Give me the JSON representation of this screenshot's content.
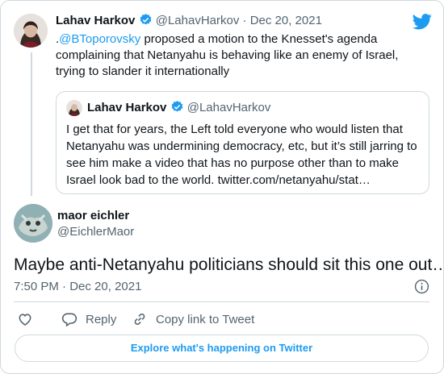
{
  "reply_to": {
    "author_name": "Lahav Harkov",
    "author_handle": "@LahavHarkov",
    "separator": "·",
    "date": "Dec 20, 2021",
    "text_prefix": ".",
    "mention": "@BToporovsky",
    "text_rest_line1": " proposed a motion to the Knesset's agenda",
    "text_line2": "complaining that Netanyahu is behaving like an enemy of Israel,",
    "text_line3": "trying to slander it internationally"
  },
  "quoted": {
    "author_name": "Lahav Harkov",
    "author_handle": "@LahavHarkov",
    "lines": [
      "I get that for years, the Left told everyone who would listen that",
      "Netanyahu was undermining democracy, etc, but it’s still jarring to",
      "see him make a video that has no purpose other than to make",
      "Israel look bad to the world. twitter.com/netanyahu/stat…"
    ]
  },
  "tweet": {
    "author_name": "maor eichler",
    "author_handle": "@EichlerMaor",
    "text": "Maybe anti-Netanyahu politicians should sit this one out…",
    "time": "7:50 PM",
    "separator": "·",
    "date": "Dec 20, 2021"
  },
  "actions": {
    "reply_label": "Reply",
    "copy_link_label": "Copy link to Tweet"
  },
  "explore_label": "Explore what's happening on Twitter",
  "icons": {
    "brand": "twitter-bird-icon",
    "verified": "verified-badge-icon",
    "info": "info-icon",
    "like": "heart-icon",
    "reply": "reply-bubble-icon",
    "copy_link": "link-icon"
  },
  "colors": {
    "brand_blue": "#1d9bf0",
    "text": "#0f1419",
    "muted": "#536471",
    "border": "#cfd9de",
    "verified": "#1d9bf0"
  }
}
